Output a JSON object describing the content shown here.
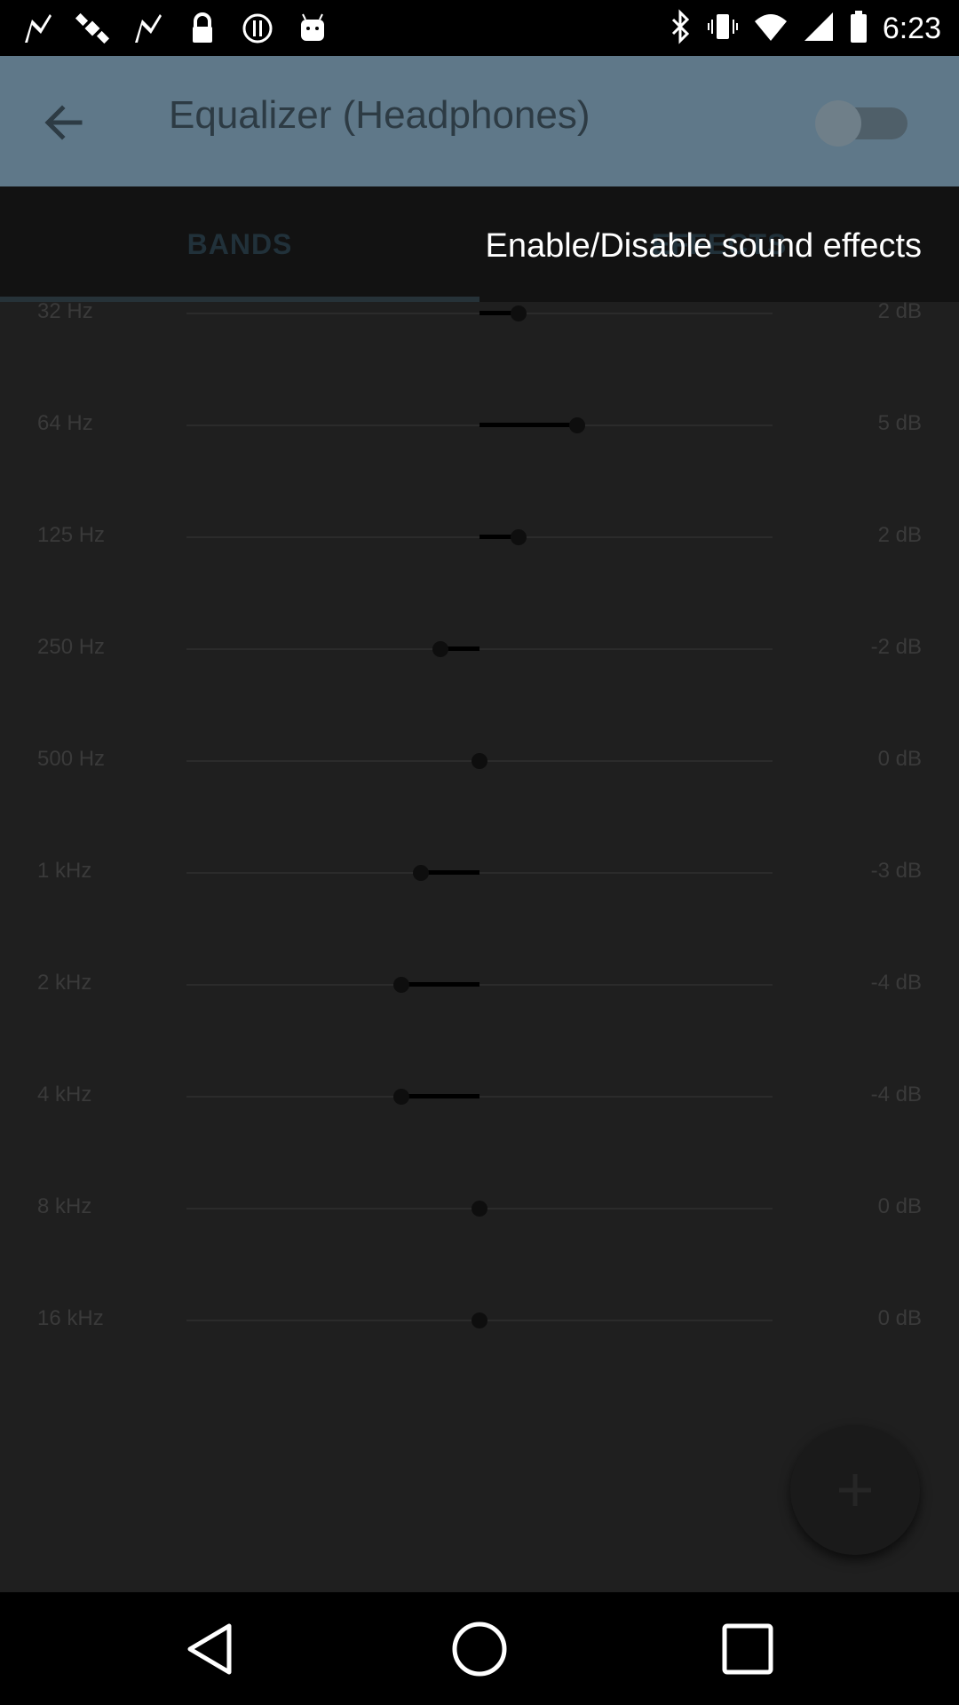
{
  "status_bar": {
    "time": "6:23",
    "left_icons": [
      "fake-gps-icon",
      "satellite-icon",
      "fake-gps-icon",
      "lock-icon",
      "circle-i-icon",
      "android-icon"
    ],
    "right_icons": [
      "bluetooth-icon",
      "vibrate-icon",
      "wifi-icon",
      "signal-icon",
      "battery-icon"
    ]
  },
  "appbar": {
    "title": "Equalizer (Headphones)",
    "toggle_on": false
  },
  "tabs": [
    {
      "label": "BANDS",
      "selected": true
    },
    {
      "label": "EFFECTS",
      "selected": false
    }
  ],
  "tooltip": "Enable/Disable sound effects",
  "bands": [
    {
      "freq": "32 Hz",
      "db_label": "2 dB",
      "db": 2
    },
    {
      "freq": "64 Hz",
      "db_label": "5 dB",
      "db": 5
    },
    {
      "freq": "125 Hz",
      "db_label": "2 dB",
      "db": 2
    },
    {
      "freq": "250 Hz",
      "db_label": "-2 dB",
      "db": -2
    },
    {
      "freq": "500 Hz",
      "db_label": "0 dB",
      "db": 0
    },
    {
      "freq": "1 kHz",
      "db_label": "-3 dB",
      "db": -3
    },
    {
      "freq": "2 kHz",
      "db_label": "-4 dB",
      "db": -4
    },
    {
      "freq": "4 kHz",
      "db_label": "-4 dB",
      "db": -4
    },
    {
      "freq": "8 kHz",
      "db_label": "0 dB",
      "db": 0
    },
    {
      "freq": "16 kHz",
      "db_label": "0 dB",
      "db": 0
    }
  ],
  "slider_range_db": [
    -15,
    15
  ],
  "fab": {
    "icon": "plus-icon"
  },
  "nav": [
    "back-triangle-icon",
    "home-circle-icon",
    "recents-square-icon"
  ],
  "colors": {
    "appbar": "#5f7889",
    "background": "#1f1f1f",
    "tabs": "#121212"
  }
}
